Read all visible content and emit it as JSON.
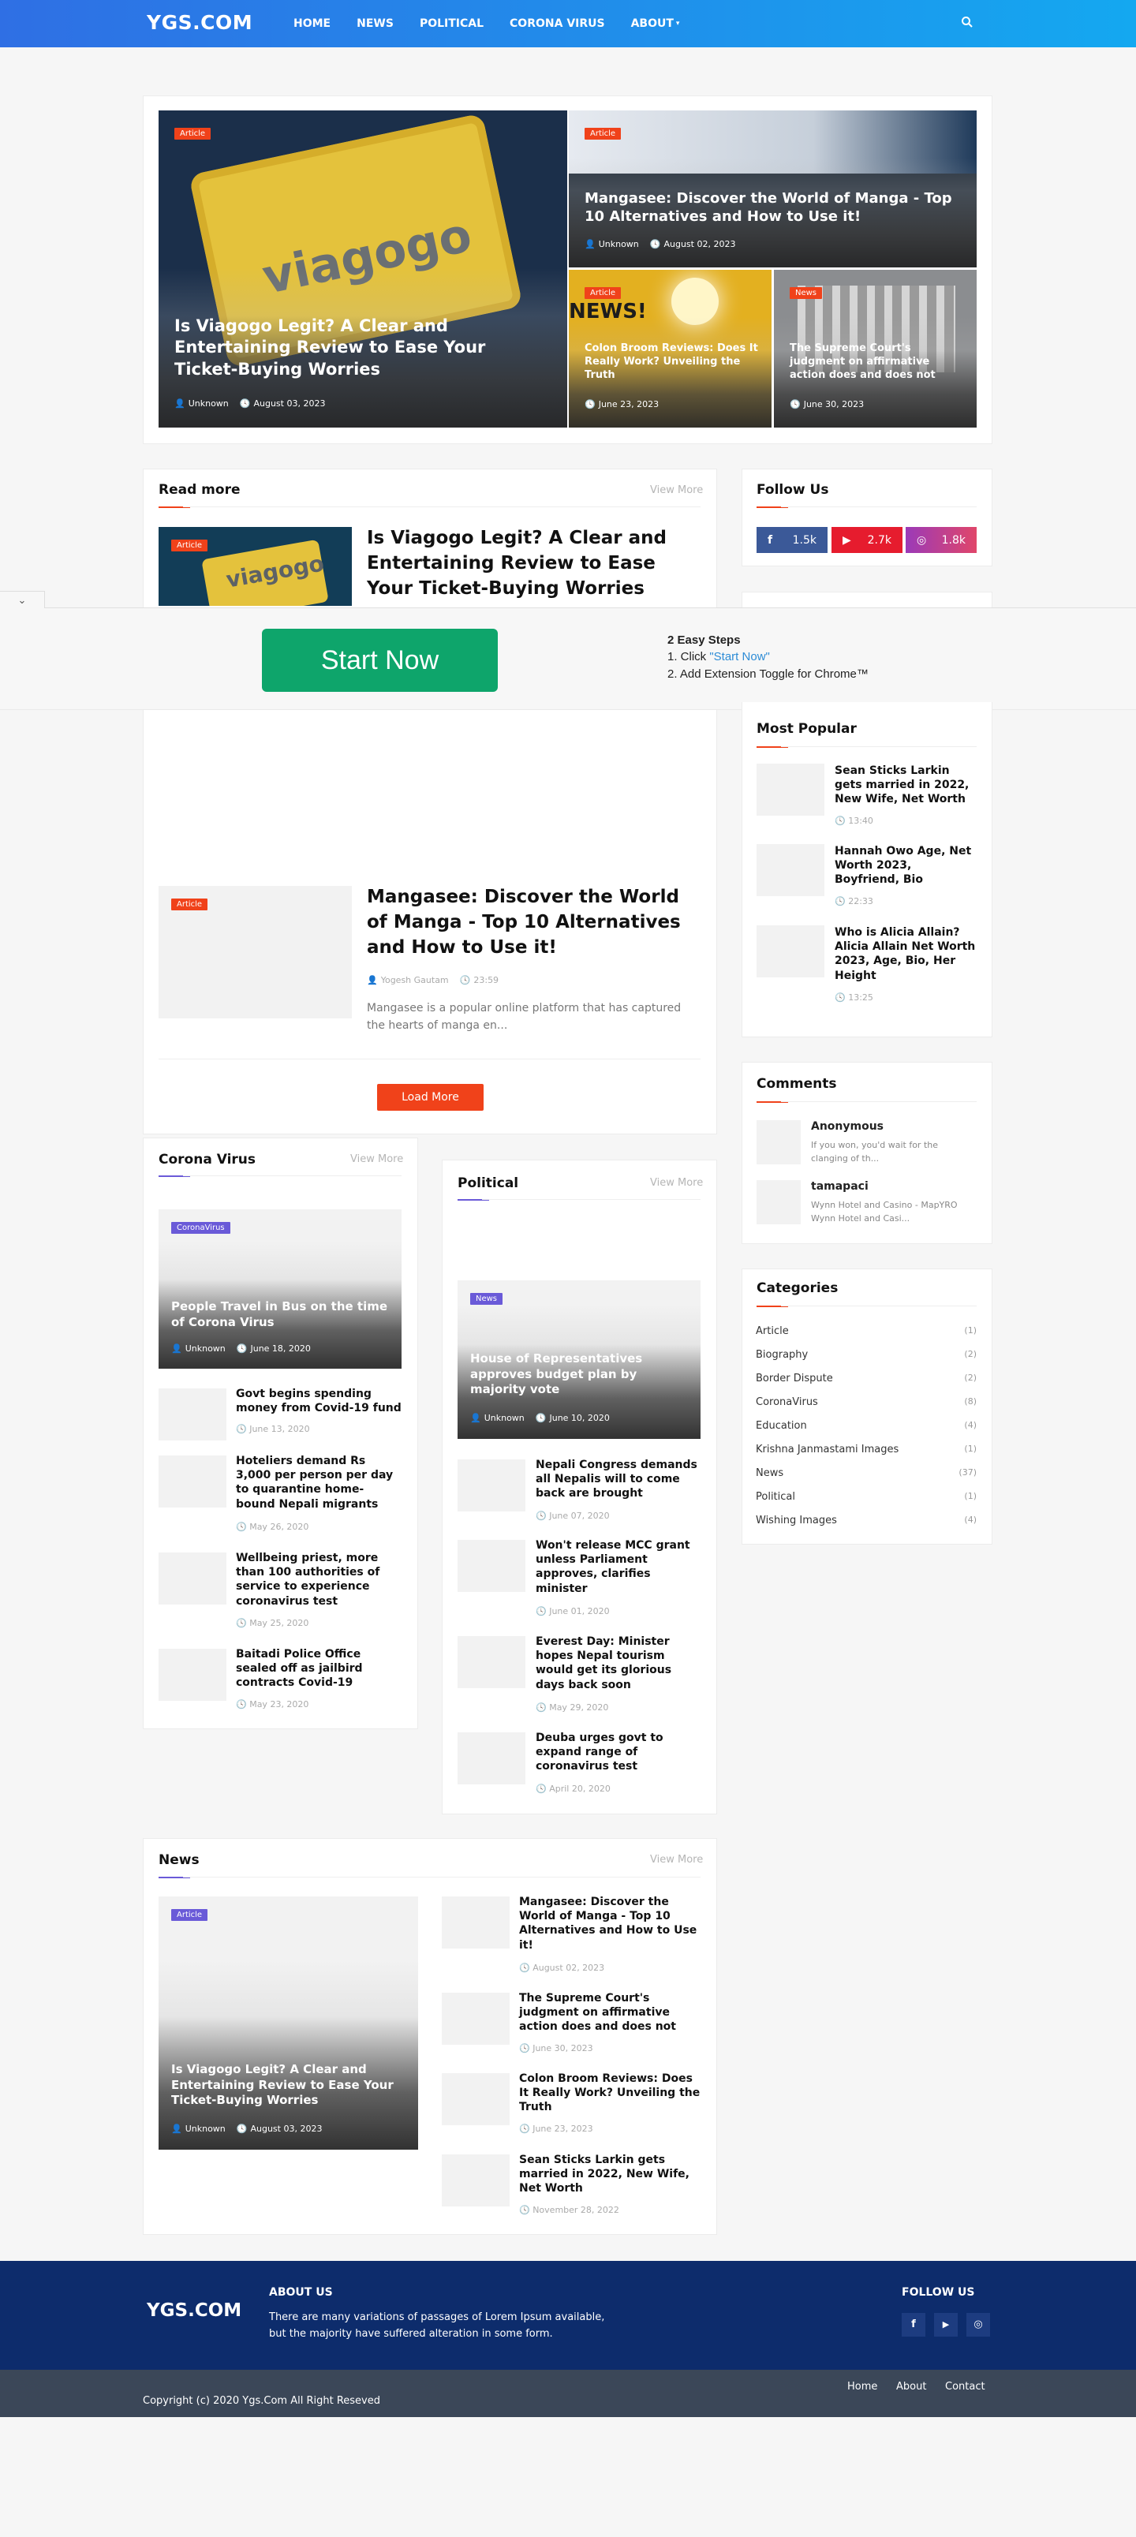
{
  "header": {
    "logo": "YGS.COM",
    "nav": [
      {
        "label": "HOME"
      },
      {
        "label": "NEWS"
      },
      {
        "label": "POLITICAL"
      },
      {
        "label": "CORONA VIRUS"
      },
      {
        "label": "ABOUT"
      }
    ],
    "search_icon": "search-icon"
  },
  "featured": {
    "main": {
      "tag": "Article",
      "title": "Is Viagogo Legit? A Clear and Entertaining Review to Ease Your Ticket-Buying Worries",
      "author": "Unknown",
      "date": "August 03, 2023",
      "image_text": "viagogo"
    },
    "top_right": {
      "tag": "Article",
      "title": "Mangasee: Discover the World of Manga - Top 10 Alternatives and How to Use it!",
      "author": "Unknown",
      "date": "August 02, 2023"
    },
    "bottom_left": {
      "tag": "Article",
      "title": "Colon Broom Reviews: Does It Really Work? Unveiling the Truth",
      "date": "June 23, 2023",
      "image_text": "NEWS!"
    },
    "bottom_right": {
      "tag": "News",
      "title": "The Supreme Court's judgment on affirmative action does and does not",
      "date": "June 30, 2023"
    }
  },
  "read_more": {
    "title": "Read more",
    "view_more": "View More",
    "post1": {
      "tag": "Article",
      "title": "Is Viagogo Legit? A Clear and Entertaining Review to Ease Your Ticket-Buying Worries",
      "image_text": "viagogo"
    },
    "post2": {
      "tag": "Article",
      "title": "Mangasee: Discover the World of Manga - Top 10 Alternatives and How to Use it!",
      "author": "Yogesh Gautam",
      "time": "23:59",
      "excerpt": "Mangasee is a popular online platform that has captured the hearts of manga en..."
    },
    "load_more": "Load More"
  },
  "ad_banner": {
    "button": "Start Now",
    "heading": "2 Easy Steps",
    "step1_prefix": "1. Click ",
    "step1_link": "\"Start Now\"",
    "step2": "2. Add Extension Toggle for Chrome™"
  },
  "follow_us": {
    "title": "Follow Us",
    "facebook": "1.5k",
    "youtube": "2.7k",
    "instagram": "1.8k"
  },
  "most_popular": {
    "title": "Most Popular",
    "items": [
      {
        "title": "Sean Sticks Larkin gets married in 2022, New Wife, Net Worth",
        "time": "13:40"
      },
      {
        "title": "Hannah Owo Age, Net Worth 2023, Boyfriend, Bio",
        "time": "22:33"
      },
      {
        "title": "Who is Alicia Allain? Alicia Allain Net Worth 2023, Age, Bio, Her Height",
        "time": "13:25"
      }
    ]
  },
  "comments": {
    "title": "Comments",
    "items": [
      {
        "name": "Anonymous",
        "text1": "If you won, you'd wait for the",
        "text2": "clanging of th..."
      },
      {
        "name": "tamapaci",
        "text1": "Wynn Hotel and Casino - MapYRO",
        "text2": "Wynn Hotel and Casi..."
      }
    ]
  },
  "categories": {
    "title": "Categories",
    "items": [
      {
        "name": "Article",
        "count": "(1)"
      },
      {
        "name": "Biography",
        "count": "(2)"
      },
      {
        "name": "Border Dispute",
        "count": "(2)"
      },
      {
        "name": "CoronaVirus",
        "count": "(8)"
      },
      {
        "name": "Education",
        "count": "(4)"
      },
      {
        "name": "Krishna Janmastami Images",
        "count": "(1)"
      },
      {
        "name": "News",
        "count": "(37)"
      },
      {
        "name": "Political",
        "count": "(1)"
      },
      {
        "name": "Wishing Images",
        "count": "(4)"
      }
    ]
  },
  "corona": {
    "title": "Corona Virus",
    "view_more": "View More",
    "main": {
      "tag": "CoronaVirus",
      "title": "People Travel in Bus on the time of Corona Virus",
      "author": "Unknown",
      "date": "June 18, 2020"
    },
    "items": [
      {
        "title": "Govt begins spending money from Covid-19 fund",
        "date": "June 13, 2020"
      },
      {
        "title": "Hoteliers demand Rs 3,000 per person per day to quarantine home-bound Nepali migrants",
        "date": "May 26, 2020"
      },
      {
        "title": "Wellbeing priest, more than 100 authorities of service to experience coronavirus test",
        "date": "May 25, 2020"
      },
      {
        "title": "Baitadi Police Office sealed off as jailbird contracts Covid-19",
        "date": "May 23, 2020"
      }
    ]
  },
  "political": {
    "title": "Political",
    "view_more": "View More",
    "main": {
      "tag": "News",
      "title": "House of Representatives approves budget plan by majority vote",
      "author": "Unknown",
      "date": "June 10, 2020"
    },
    "items": [
      {
        "title": "Nepali Congress demands all Nepalis will to come back are brought",
        "date": "June 07, 2020"
      },
      {
        "title": "Won't release MCC grant unless Parliament approves, clarifies minister",
        "date": "June 01, 2020"
      },
      {
        "title": "Everest Day: Minister hopes Nepal tourism would get its glorious days back soon",
        "date": "May 29, 2020"
      },
      {
        "title": "Deuba urges govt to expand range of coronavirus test",
        "date": "April 20, 2020"
      }
    ]
  },
  "news": {
    "title": "News",
    "view_more": "View More",
    "main": {
      "tag": "Article",
      "title": "Is Viagogo Legit? A Clear and Entertaining Review to Ease Your Ticket-Buying Worries",
      "author": "Unknown",
      "date": "August 03, 2023"
    },
    "items": [
      {
        "title": "Mangasee: Discover the World of Manga - Top 10 Alternatives and How to Use it!",
        "date": "August 02, 2023"
      },
      {
        "title": "The Supreme Court's judgment on affirmative action does and does not",
        "date": "June 30, 2023"
      },
      {
        "title": "Colon Broom Reviews: Does It Really Work? Unveiling the Truth",
        "date": "June 23, 2023"
      },
      {
        "title": "Sean Sticks Larkin gets married in 2022, New Wife, Net Worth",
        "date": "November 28, 2022"
      }
    ]
  },
  "footer": {
    "logo": "YGS.COM",
    "about_title": "ABOUT US",
    "about_text1": "There are many variations of passages of Lorem Ipsum available,",
    "about_text2": "but the majority have suffered alteration in some form.",
    "follow_title": "FOLLOW US",
    "copyright": "Copyright (c) 2020 Ygs.Com All Right Reseved",
    "links": [
      {
        "label": "Home"
      },
      {
        "label": "About"
      },
      {
        "label": "Contact"
      }
    ]
  },
  "colors": {
    "accent": "#f0421a",
    "purple": "#6a5ad8",
    "header_start": "#2f6fe4",
    "header_end": "#14a8f0",
    "footer": "#0d2c6c",
    "footer_bottom": "#3b4758",
    "start_now": "#0ea56b"
  }
}
